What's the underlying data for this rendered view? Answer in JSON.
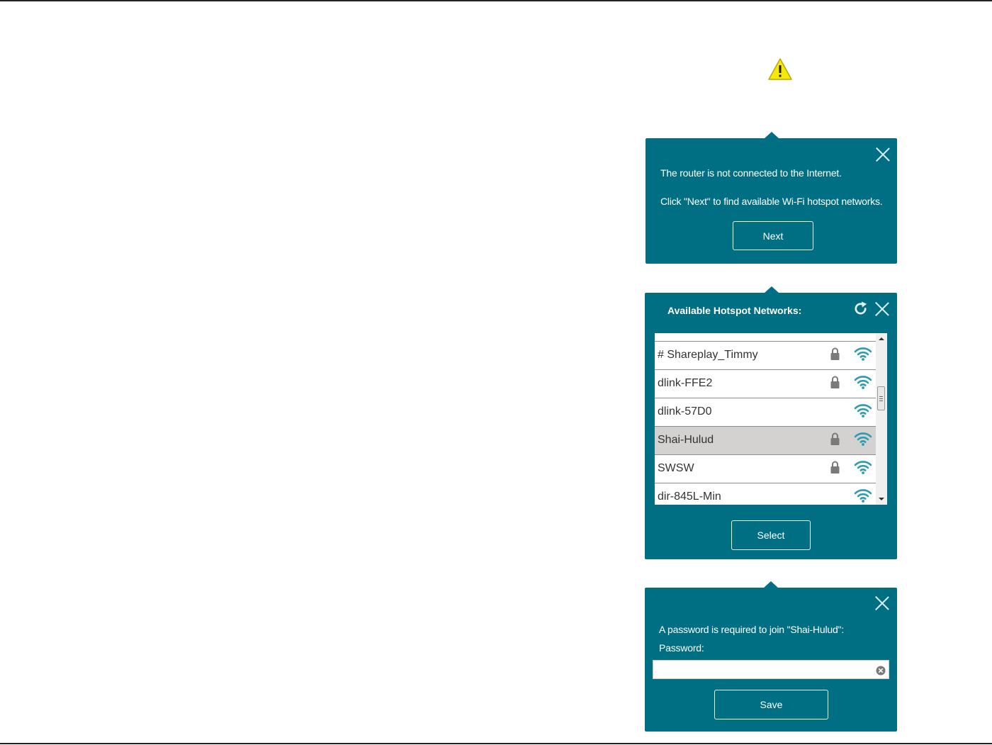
{
  "colors": {
    "panel_bg": "#006f83",
    "wifi_icon": "#2e9bb0",
    "lock_icon": "#7a7a7a",
    "selected_row": "#d3d2d1",
    "warning": "#f6e80a"
  },
  "alert_panel": {
    "line1": "The router is not connected to the Internet.",
    "line2": "Click \"Next\" to find available Wi-Fi hotspot networks.",
    "next_label": "Next"
  },
  "hotspot_panel": {
    "title": "Available Hotspot Networks:",
    "networks": [
      {
        "name": "# Shareplay_Timmy",
        "locked": true,
        "selected": false
      },
      {
        "name": "dlink-FFE2",
        "locked": true,
        "selected": false
      },
      {
        "name": "dlink-57D0",
        "locked": false,
        "selected": false
      },
      {
        "name": "Shai-Hulud",
        "locked": true,
        "selected": true
      },
      {
        "name": "SWSW",
        "locked": true,
        "selected": false
      },
      {
        "name": "dir-845L-Min",
        "locked": false,
        "selected": false
      }
    ],
    "select_label": "Select"
  },
  "password_panel": {
    "message": "A password is required to join \"Shai-Hulud\":",
    "password_label": "Password:",
    "password_value": "",
    "save_label": "Save"
  }
}
